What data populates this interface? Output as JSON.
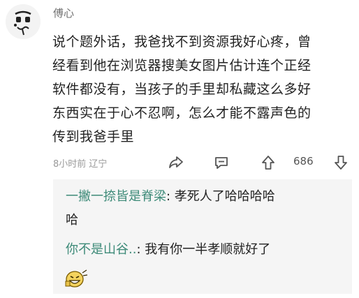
{
  "post": {
    "author": "傅心",
    "content_lines": [
      "说个题外话，我爸找不到资源我好心疼，曾",
      "经看到他在浏览器搜美女图片估计连个正经",
      "软件都没有，当孩子的手里却私藏这么多好",
      "东西实在于心不忍啊，怎么才能不露声色的",
      "传到我爸手里"
    ],
    "time": "8小时前",
    "location": "辽宁",
    "like_count": "686"
  },
  "replies": [
    {
      "author": "一撇一捺皆是脊梁",
      "separator": ": ",
      "text_line1": "孝死人了哈哈哈哈",
      "text_line2": "哈"
    },
    {
      "author": "你不是山谷..",
      "separator": ": ",
      "text_line1": "我有你一半孝顺就好了",
      "sticker": "grinning-sticker-icon"
    }
  ],
  "icons": {
    "share": "share-icon",
    "comment": "comment-icon",
    "upvote": "upvote-icon",
    "downvote": "downvote-icon"
  },
  "colors": {
    "reply_author": "#3d8a78",
    "meta_text": "#9a9a9a",
    "reply_bg": "#f5f5f5"
  }
}
